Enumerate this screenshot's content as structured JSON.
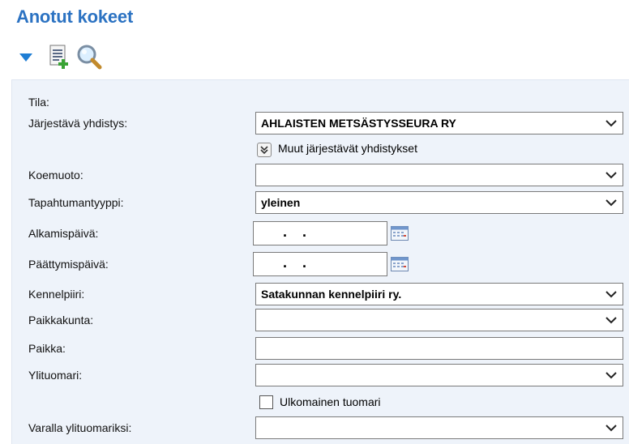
{
  "page": {
    "title": "Anotut kokeet"
  },
  "icons": {
    "collapse": "triangle-down-icon",
    "add": "add-document-icon",
    "search": "magnifier-icon",
    "calendar": "calendar-icon",
    "expand": "double-chevron-down-icon",
    "dropdown": "chevron-down-icon"
  },
  "colors": {
    "title": "#2b72c2",
    "panel": "#eef3fa",
    "triangle": "#1f7ed4"
  },
  "form": {
    "tila": {
      "label": "Tila:"
    },
    "jarjestava": {
      "label": "Järjestävä yhdistys:",
      "value": "AHLAISTEN METSÄSTYSSEURA RY"
    },
    "muut": {
      "label": "Muut järjestävät yhdistykset"
    },
    "koemuoto": {
      "label": "Koemuoto:",
      "value": ""
    },
    "tapahtumantyyppi": {
      "label": "Tapahtumantyyppi:",
      "value": "yleinen"
    },
    "alkamispaiva": {
      "label": "Alkamispäivä:",
      "value": ". ."
    },
    "paattymispaiva": {
      "label": "Päättymispäivä:",
      "value": ". ."
    },
    "kennelpiiri": {
      "label": "Kennelpiiri:",
      "value": "Satakunnan kennelpiiri ry."
    },
    "paikkakunta": {
      "label": "Paikkakunta:",
      "value": ""
    },
    "paikka": {
      "label": "Paikka:",
      "value": ""
    },
    "ylituomari": {
      "label": "Ylituomari:",
      "value": ""
    },
    "ulkomainen": {
      "label": "Ulkomainen tuomari",
      "checked": false
    },
    "varalla": {
      "label": "Varalla ylituomariksi:",
      "value": ""
    }
  }
}
